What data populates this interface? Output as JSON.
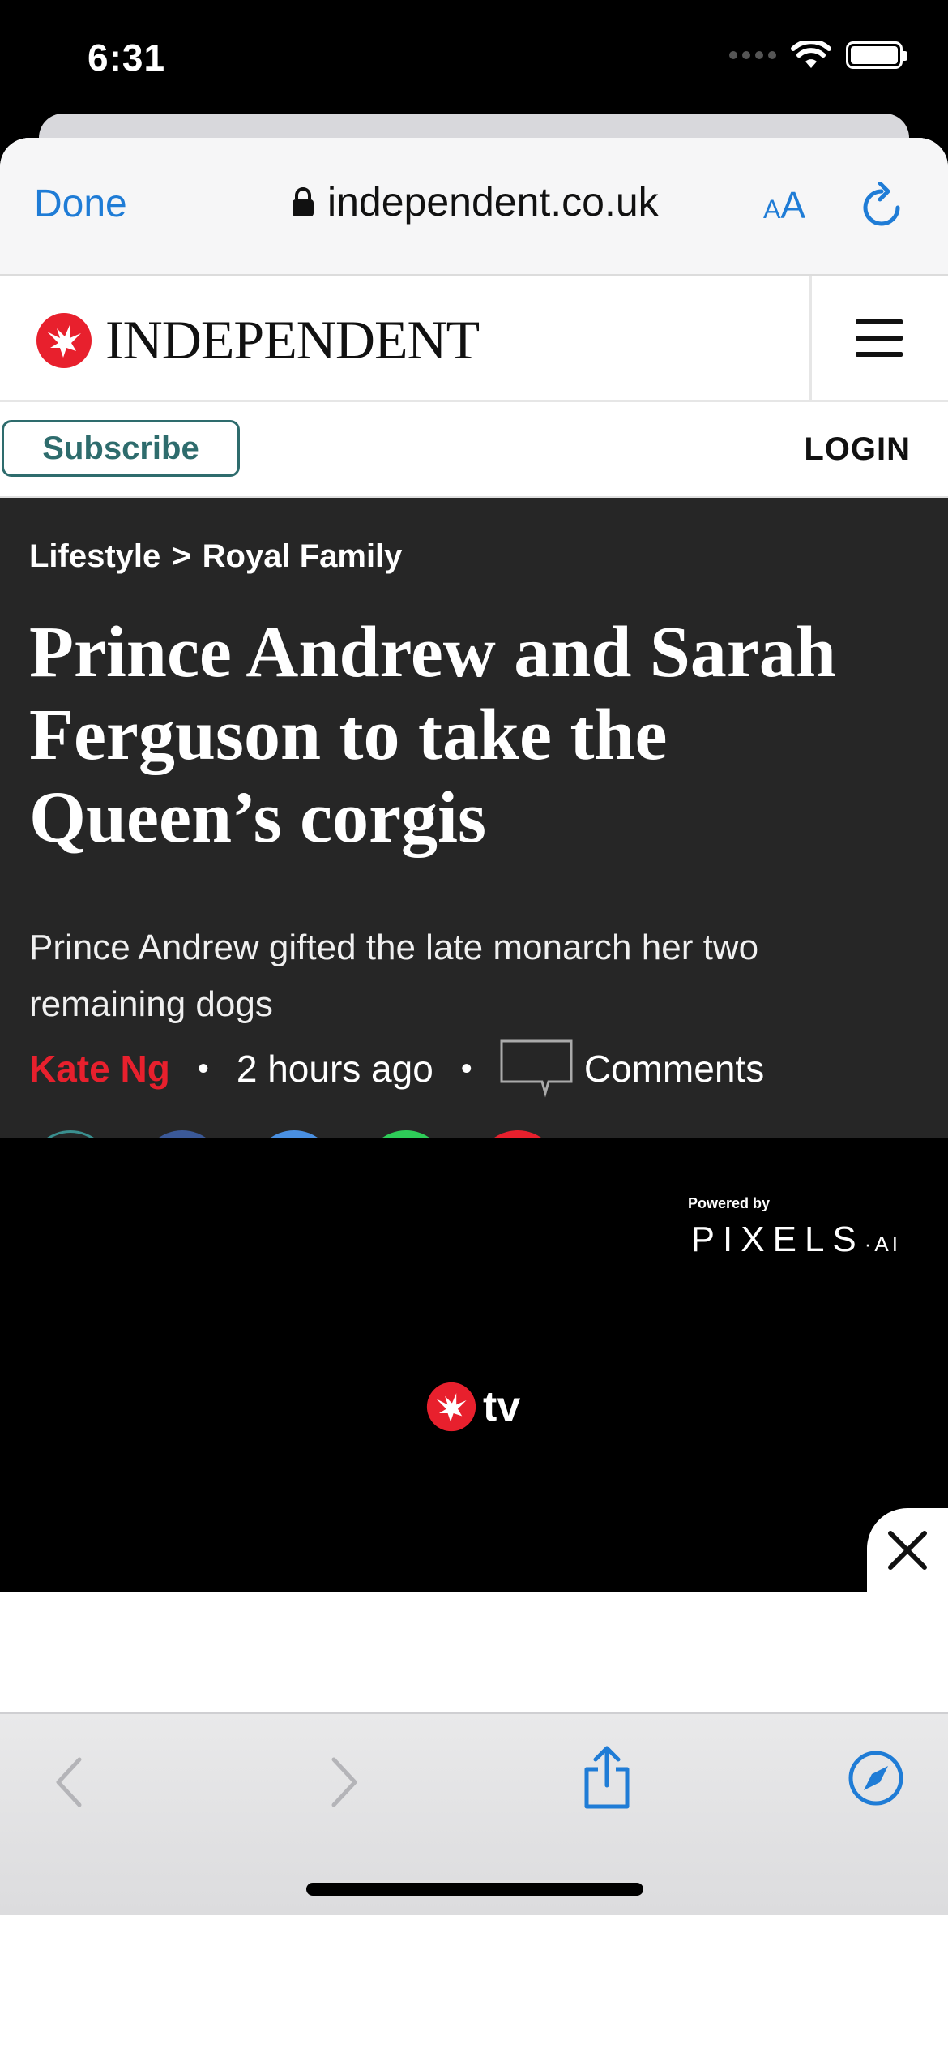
{
  "status_bar": {
    "time": "6:31"
  },
  "safari": {
    "done_label": "Done",
    "url": "independent.co.uk",
    "aa_label_small": "A",
    "aa_label_large": "A"
  },
  "site_header": {
    "logo_text": "INDEPENDENT"
  },
  "subscribe_bar": {
    "subscribe_label": "Subscribe",
    "login_label": "LOGIN"
  },
  "article": {
    "breadcrumb": [
      "Lifestyle",
      ">",
      "Royal Family"
    ],
    "headline": "Prince Andrew and Sarah Ferguson to take the Queen’s corgis",
    "standfirst": "Prince Andrew gifted the late monarch her two remaining dogs",
    "author": "Kate Ng",
    "separator": "•",
    "time_ago": "2 hours ago",
    "comments_label": "Comments",
    "share_buttons": [
      "bookmark-icon",
      "facebook-icon",
      "twitter-icon",
      "whatsapp-icon",
      "email-icon"
    ]
  },
  "video": {
    "powered_by": "Powered by",
    "pixels_brand": "PIXELS",
    "pixels_suffix": "·AI",
    "tv_label": "tv"
  },
  "colors": {
    "safari_blue": "#1f7cd6",
    "independent_red": "#e8202d",
    "subscribe_teal": "#2e6c6d",
    "article_bg": "#262626",
    "facebook": "#3b5998",
    "twitter": "#4a90e2",
    "whatsapp": "#2ecc58",
    "email": "#e8202d"
  }
}
